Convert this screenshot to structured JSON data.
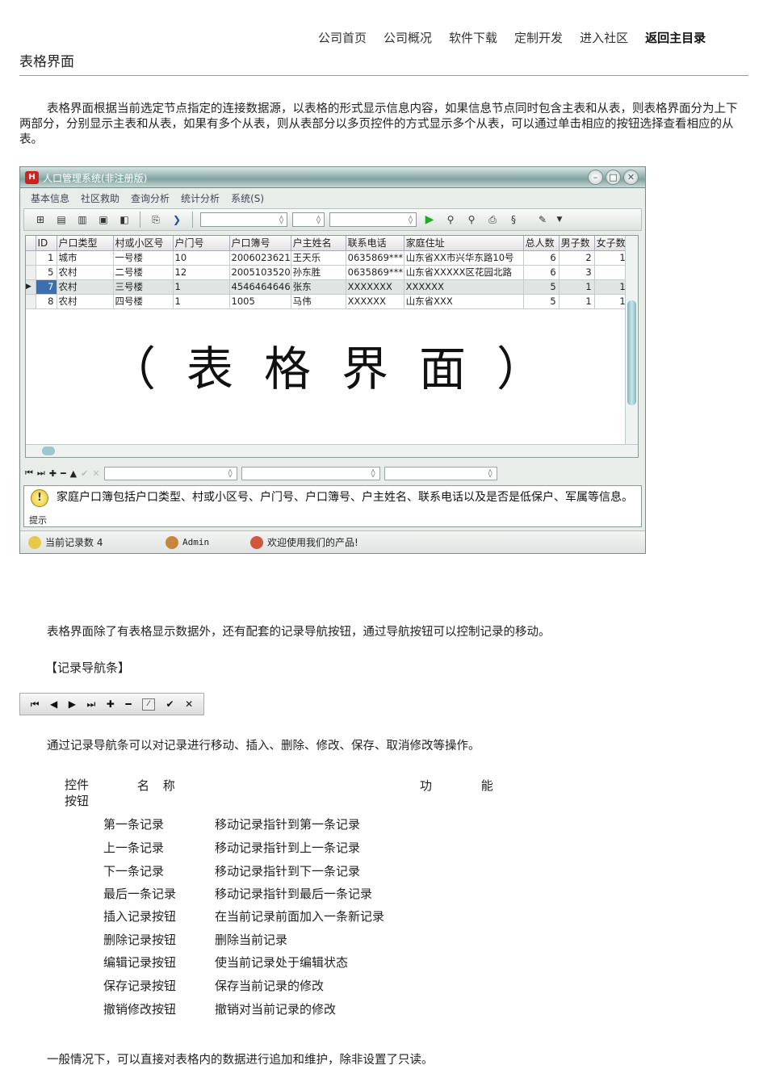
{
  "nav": [
    "公司首页",
    "公司概况",
    "软件下载",
    "定制开发",
    "进入社区",
    "返回主目录"
  ],
  "page_title": "表格界面",
  "intro": "表格界面根据当前选定节点指定的连接数据源，以表格的形式显示信息内容，如果信息节点同时包含主表和从表，则表格界面分为上下两部分，分别显示主表和从表，如果有多个从表，则从表部分以多页控件的方式显示多个从表，可以通过单击相应的按钮选择查看相应的从表。",
  "app": {
    "title": "人口管理系统(非注册版)",
    "menu": [
      "基本信息",
      "社区救助",
      "查询分析",
      "统计分析",
      "系统(S)"
    ],
    "columns": [
      "ID",
      "户口类型",
      "村或小区号",
      "户门号",
      "户口簿号",
      "户主姓名",
      "联系电话",
      "家庭住址",
      "总人数",
      "男子数",
      "女子数"
    ],
    "rows": [
      [
        "1",
        "城市",
        "一号楼",
        "10",
        "2006023621",
        "王天乐",
        "0635869***",
        "山东省XX市兴华东路10号",
        "6",
        "2",
        "1"
      ],
      [
        "5",
        "农村",
        "二号楼",
        "12",
        "2005103520",
        "孙东胜",
        "0635869***",
        "山东省XXXXX区花园北路",
        "6",
        "3",
        ""
      ],
      [
        "7",
        "农村",
        "三号楼",
        "1",
        "4546464646",
        "张东",
        "XXXXXXX",
        "XXXXXX",
        "5",
        "1",
        "1"
      ],
      [
        "8",
        "农村",
        "四号楼",
        "1",
        "1005",
        "马伟",
        "XXXXXX",
        "山东省XXX",
        "5",
        "1",
        "1"
      ]
    ],
    "overlay": "（表格界面）",
    "hint_label": "提示",
    "hint_text": "家庭户口簿包括户口类型、村或小区号、户门号、户口簿号、户主姓名、联系电话以及是否是低保户、军属等信息。",
    "status": {
      "records": "当前记录数 4",
      "user": "Admin",
      "welcome": "欢迎使用我们的产品!"
    }
  },
  "para2": "表格界面除了有表格显示数据外，还有配套的记录导航按钮，通过导航按钮可以控制记录的移动。",
  "nav_heading": "【记录导航条】",
  "para3": "通过记录导航条可以对记录进行移动、插入、删除、修改、保存、取消修改等操作。",
  "table_header": {
    "col1": "控件按钮",
    "col2": "名 称",
    "col3": "功 能"
  },
  "controls": [
    {
      "name": "第一条记录",
      "desc": "移动记录指针到第一条记录"
    },
    {
      "name": "上一条记录",
      "desc": "移动记录指针到上一条记录"
    },
    {
      "name": "下一条记录",
      "desc": "移动记录指针到下一条记录"
    },
    {
      "name": "最后一条记录",
      "desc": "移动记录指针到最后一条记录"
    },
    {
      "name": "插入记录按钮",
      "desc": "在当前记录前面加入一条新记录"
    },
    {
      "name": "删除记录按钮",
      "desc": "删除当前记录"
    },
    {
      "name": "编辑记录按钮",
      "desc": "使当前记录处于编辑状态"
    },
    {
      "name": "保存记录按钮",
      "desc": "保存当前记录的修改"
    },
    {
      "name": "撤销修改按钮",
      "desc": "撤销对当前记录的修改"
    }
  ],
  "footer": "一般情况下，可以直接对表格内的数据进行追加和维护，除非设置了只读。"
}
